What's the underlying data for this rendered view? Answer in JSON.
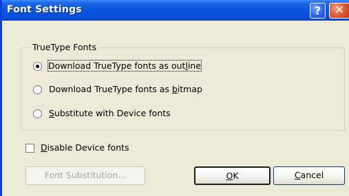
{
  "window": {
    "title": "Font Settings",
    "help_glyph": "?",
    "close_glyph": "✕"
  },
  "truetype_group": {
    "legend": "TrueType Fonts",
    "options": [
      {
        "pre": "Download TrueType fonts as ",
        "ul": "",
        "post": "outline",
        "checked": true
      },
      {
        "pre": "Download TrueType fonts as ",
        "ul": "b",
        "post": "itmap",
        "checked": false
      },
      {
        "pre": "",
        "ul": "S",
        "post": "ubstitute with Device fonts",
        "checked": false
      }
    ],
    "outline_ul_pre": "out",
    "outline_ul": "l",
    "outline_ul_post": "ine"
  },
  "disable_device_fonts": {
    "ul": "D",
    "rest": "isable Device fonts",
    "checked": false
  },
  "buttons": {
    "font_substitution": "Font Substitution...",
    "ok_ul": "O",
    "ok_rest": "K",
    "cancel_ul": "C",
    "cancel_rest": "ancel"
  },
  "colors": {
    "titlebar": "#0a56e0",
    "dialog_bg": "#ece9d8",
    "close_button": "#de5530"
  }
}
